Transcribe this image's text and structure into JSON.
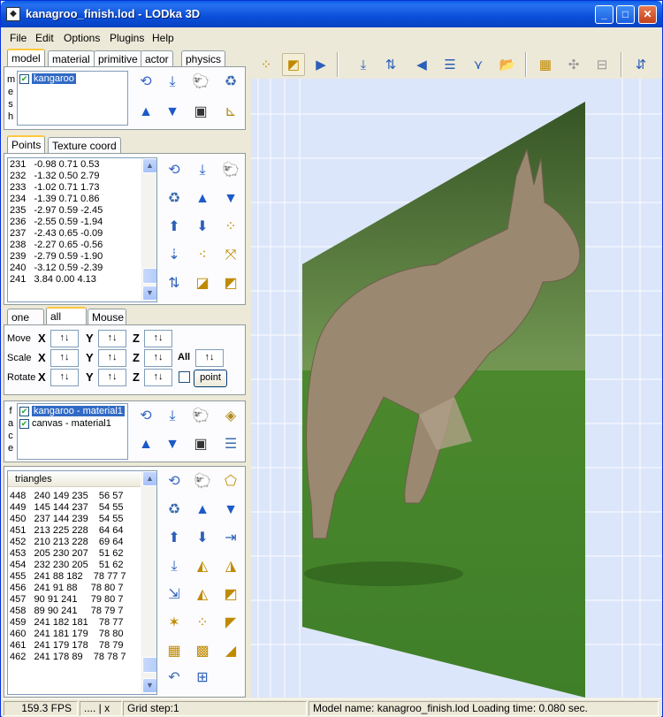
{
  "window": {
    "title": "kanagroo_finish.lod - LODka 3D",
    "minimize": "_",
    "maximize": "□",
    "close": "✕"
  },
  "menu": [
    "File",
    "Edit",
    "Options",
    "Plugins",
    "Help"
  ],
  "object_tabs": [
    "model",
    "material",
    "primitive",
    "actor",
    "physics"
  ],
  "mesh_label": [
    "m",
    "e",
    "s",
    "h"
  ],
  "mesh_list": [
    {
      "name": "kangaroo",
      "checked": true,
      "selected": true
    }
  ],
  "points_tabs": [
    "Points",
    "Texture coord"
  ],
  "points": [
    "231   -0.98 0.71 0.53",
    "232   -1.32 0.50 2.79",
    "233   -1.02 0.71 1.73",
    "234   -1.39 0.71 0.86",
    "235   -2.97 0.59 -2.45",
    "236   -2.55 0.59 -1.94",
    "237   -2.43 0.65 -0.09",
    "238   -2.27 0.65 -0.56",
    "239   -2.79 0.59 -1.90",
    "240   -3.12 0.59 -2.39",
    "241   3.84 0.00 4.13"
  ],
  "transform_tabs": [
    "one",
    "all",
    "Mouse"
  ],
  "transform": {
    "move": "Move",
    "scale": "Scale",
    "rotate": "Rotate",
    "x": "X",
    "y": "Y",
    "z": "Z",
    "all": "All",
    "spin": "↑↓",
    "point_button": "point"
  },
  "face_label": [
    "f",
    "a",
    "c",
    "e"
  ],
  "face_list": [
    {
      "name": "kangaroo - material1",
      "checked": true,
      "selected": true
    },
    {
      "name": "canvas - material1",
      "checked": true,
      "selected": false
    }
  ],
  "triangles_header": "triangles",
  "triangles": [
    "448   240 149 235    56 57",
    "449   145 144 237    54 55",
    "450   237 144 239    54 55",
    "451   213 225 228    64 64",
    "452   210 213 228    69 64",
    "453   205 230 207    51 62",
    "454   232 230 205    51 62",
    "455   241 88 182    78 77 7",
    "456   241 91 88     78 80 7",
    "457   90 91 241     79 80 7",
    "458   89 90 241     78 79 7",
    "459   241 182 181    78 77",
    "460   241 181 179    78 80",
    "461   241 179 178    78 79",
    "462   241 178 89    78 78 7"
  ],
  "status": {
    "fps": "159.3 FPS",
    "coords": ".... | x",
    "grid": "Grid step:1",
    "info": "Model name: kanagroo_finish.lod Loading time: 0.080 sec."
  },
  "colors": {
    "titlebar": "#0a4fd9",
    "viewport_bg": "#dce6fa",
    "grid": "#ffffff",
    "grass": "#4f8a2e",
    "kangaroo": "#9a8870"
  }
}
